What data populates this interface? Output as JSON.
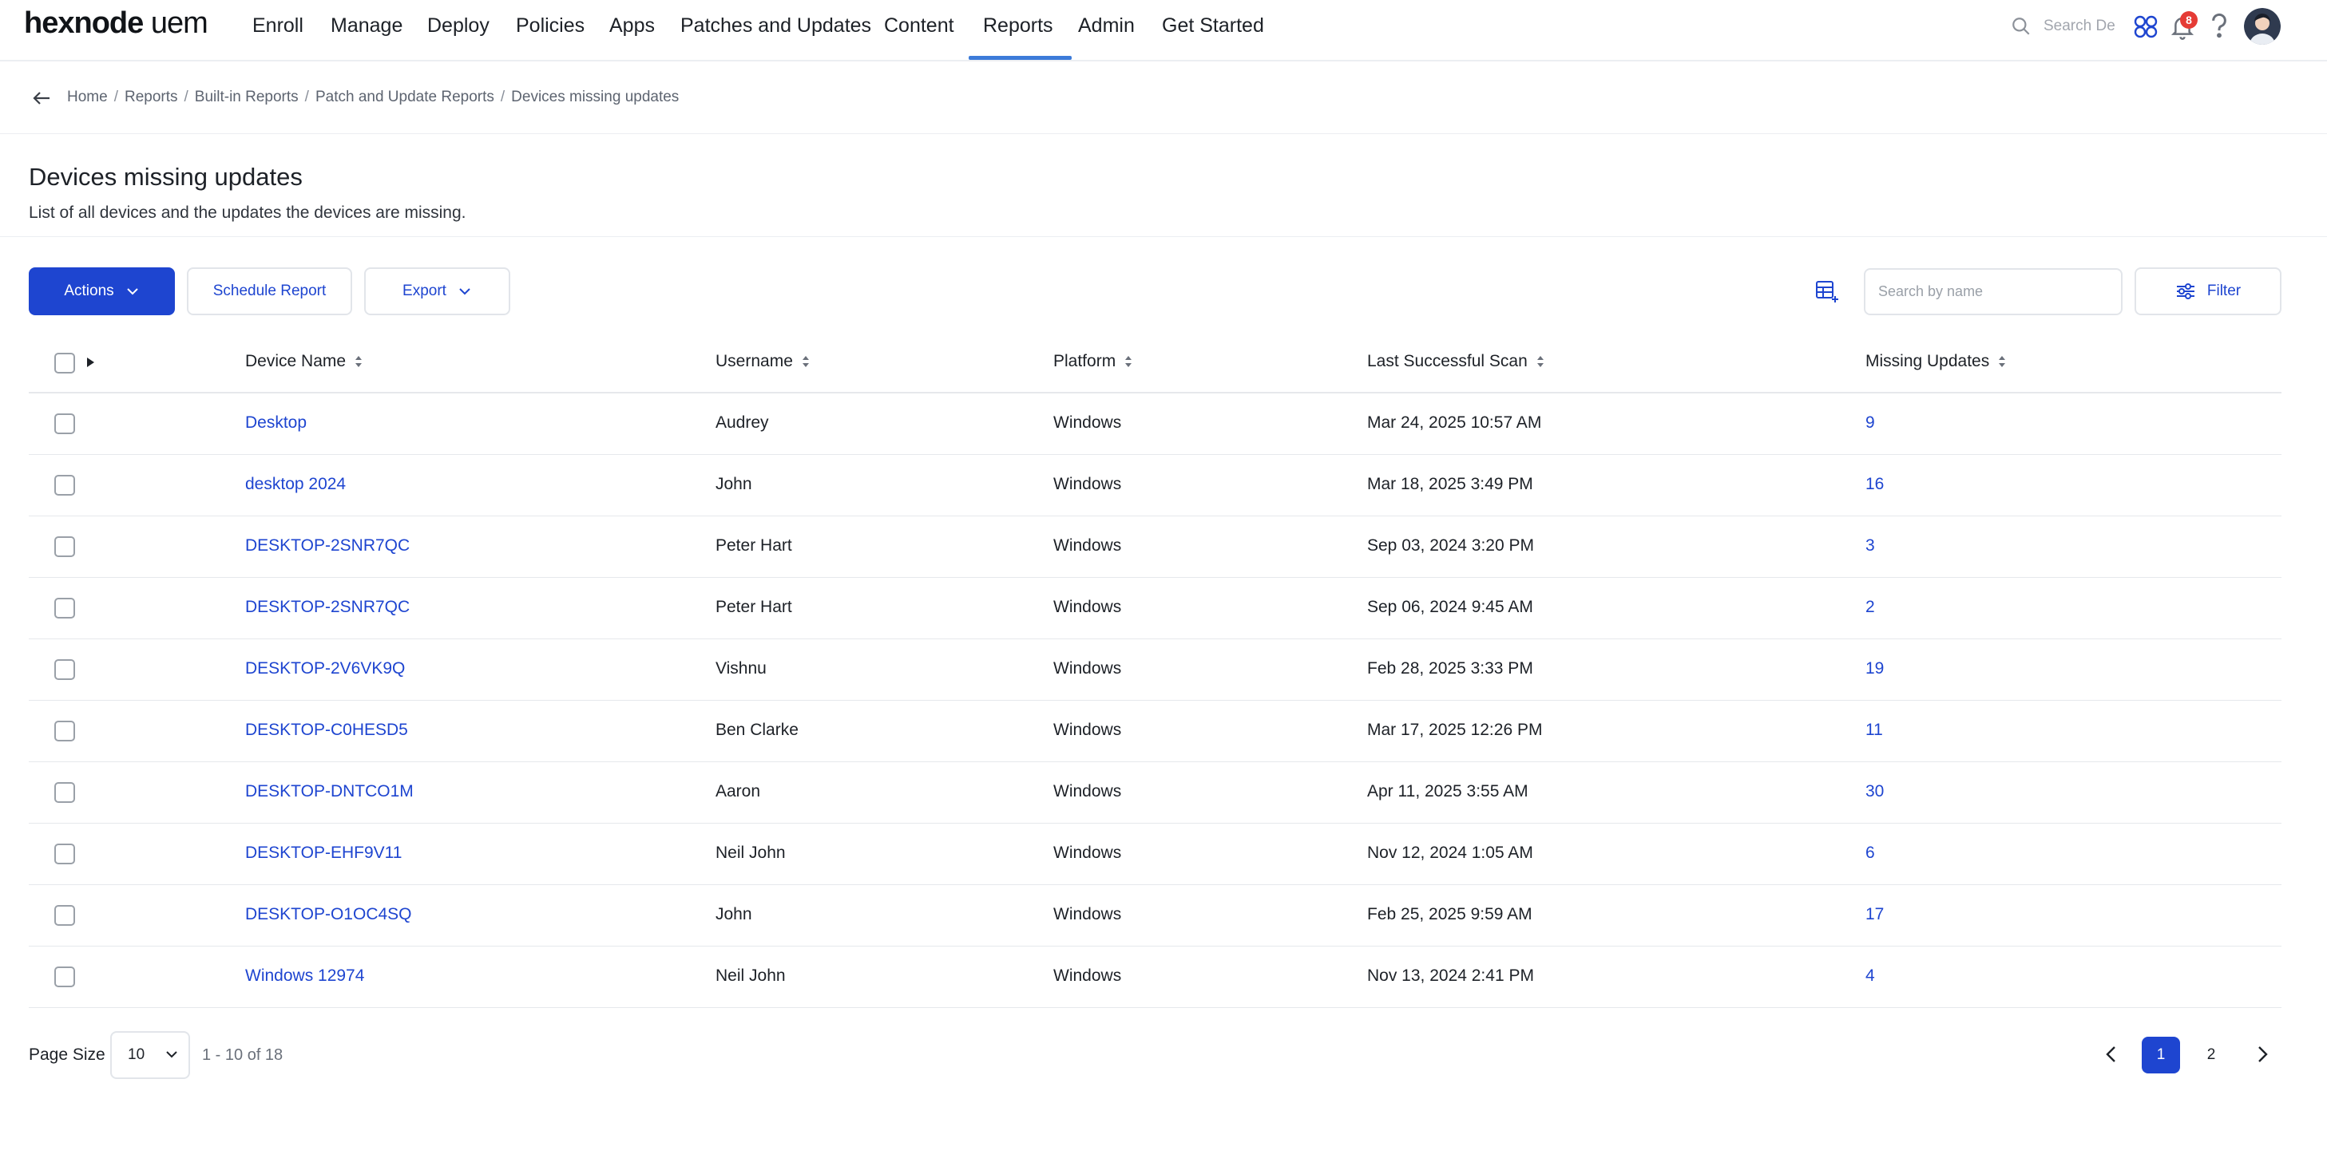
{
  "app": {
    "logo_main": "hexnode",
    "logo_suffix": "uem"
  },
  "nav": {
    "items": [
      "Enroll",
      "Manage",
      "Deploy",
      "Policies",
      "Apps",
      "Patches and Updates",
      "Content",
      "Reports",
      "Admin",
      "Get Started"
    ],
    "active": "Reports",
    "search_placeholder": "Search De",
    "notification_count": "8"
  },
  "breadcrumb": [
    "Home",
    "Reports",
    "Built-in Reports",
    "Patch and Update Reports",
    "Devices missing updates"
  ],
  "page": {
    "title": "Devices missing updates",
    "description": "List of all devices and the updates the devices are missing."
  },
  "toolbar": {
    "actions_label": "Actions",
    "schedule_label": "Schedule Report",
    "export_label": "Export",
    "search_placeholder": "Search by name",
    "filter_label": "Filter"
  },
  "table": {
    "columns": [
      "Device Name",
      "Username",
      "Platform",
      "Last Successful Scan",
      "Missing Updates"
    ],
    "rows": [
      {
        "device": "Desktop",
        "user": "Audrey",
        "platform": "Windows",
        "scan": "Mar 24, 2025 10:57 AM",
        "missing": "9"
      },
      {
        "device": "desktop 2024",
        "user": "John",
        "platform": "Windows",
        "scan": "Mar 18, 2025 3:49 PM",
        "missing": "16"
      },
      {
        "device": "DESKTOP-2SNR7QC",
        "user": "Peter Hart",
        "platform": "Windows",
        "scan": "Sep 03, 2024 3:20 PM",
        "missing": "3"
      },
      {
        "device": "DESKTOP-2SNR7QC",
        "user": "Peter Hart",
        "platform": "Windows",
        "scan": "Sep 06, 2024 9:45 AM",
        "missing": "2"
      },
      {
        "device": "DESKTOP-2V6VK9Q",
        "user": "Vishnu",
        "platform": "Windows",
        "scan": "Feb 28, 2025 3:33 PM",
        "missing": "19"
      },
      {
        "device": "DESKTOP-C0HESD5",
        "user": "Ben Clarke",
        "platform": "Windows",
        "scan": "Mar 17, 2025 12:26 PM",
        "missing": "11"
      },
      {
        "device": "DESKTOP-DNTCO1M",
        "user": "Aaron",
        "platform": "Windows",
        "scan": "Apr 11, 2025 3:55 AM",
        "missing": "30"
      },
      {
        "device": "DESKTOP-EHF9V11",
        "user": "Neil John",
        "platform": "Windows",
        "scan": "Nov 12, 2024 1:05 AM",
        "missing": "6"
      },
      {
        "device": "DESKTOP-O1OC4SQ",
        "user": "John",
        "platform": "Windows",
        "scan": "Feb 25, 2025 9:59 AM",
        "missing": "17"
      },
      {
        "device": "Windows 12974",
        "user": "Neil John",
        "platform": "Windows",
        "scan": "Nov 13, 2024 2:41 PM",
        "missing": "4"
      }
    ]
  },
  "pagination": {
    "page_size_label": "Page Size",
    "page_size": "10",
    "range": "1 - 10 of 18",
    "pages": [
      "1",
      "2"
    ],
    "current": "1"
  },
  "colors": {
    "primary": "#1e45d0",
    "nav_underline": "#3c7bd9",
    "badge": "#e53b35"
  },
  "icons": [
    "search-icon",
    "integration-icon",
    "bell-icon",
    "help-icon",
    "avatar",
    "back-arrow-icon",
    "chevron-down-icon",
    "column-settings-icon",
    "filter-icon",
    "sort-icon",
    "caret-right-icon",
    "chevron-left-icon",
    "chevron-right-icon"
  ]
}
